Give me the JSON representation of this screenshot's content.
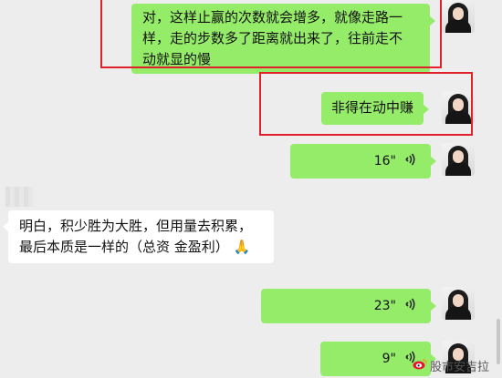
{
  "messages": {
    "m1_line1": "对，这样止赢的次数就会增多，就像走路一",
    "m1_line2": "样，走的步数多了距离就出来了，往前走不",
    "m1_line3": "动就显的慢",
    "m2": "非得在动中赚",
    "m3_duration": "16\"",
    "m4_line1": "明白，积少胜为大胜，但用量去积累，",
    "m4_line2": "最后本质是一样的（总资 金盈利）",
    "m4_emoji": "🙏",
    "m5_duration": "23\"",
    "m6_duration": "9\""
  },
  "watermark": {
    "icon": "weibo-icon",
    "text": "股市安吉拉"
  },
  "colors": {
    "bubble_green": "#95ec69",
    "highlight_red": "#e0202a"
  }
}
